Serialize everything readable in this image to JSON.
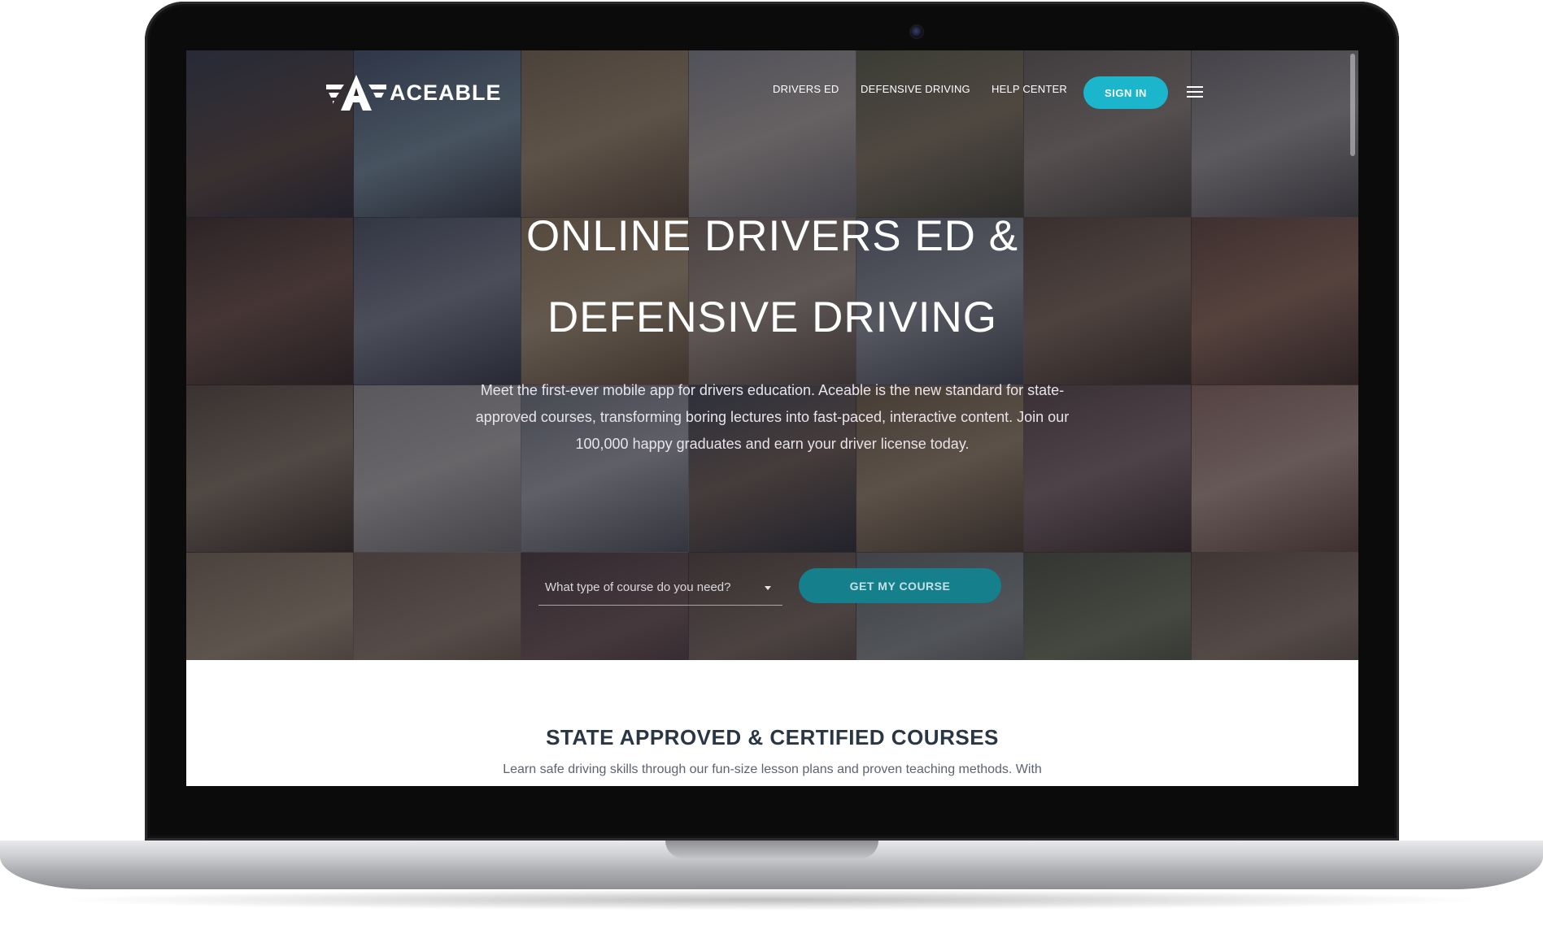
{
  "nav": {
    "logo_text": "ACEABLE",
    "links": [
      "DRIVERS ED",
      "DEFENSIVE DRIVING",
      "HELP CENTER"
    ],
    "sign_in": "SIGN IN"
  },
  "hero": {
    "title_line1": "ONLINE DRIVERS ED &",
    "title_line2": "DEFENSIVE DRIVING",
    "subtitle_line1": "Meet the first-ever mobile app for drivers education. Aceable is the new standard for state-",
    "subtitle_line2": "approved courses, transforming boring lectures into fast-paced, interactive content. Join our",
    "subtitle_line3": "100,000 happy graduates and earn your driver license today.",
    "select_placeholder": "What type of course do you need?",
    "cta": "GET MY COURSE"
  },
  "section": {
    "title": "STATE APPROVED & CERTIFIED COURSES",
    "text": "Learn safe driving skills through our fun-size lesson plans and proven teaching methods. With"
  },
  "colors": {
    "accent": "#1bb5cc",
    "cta": "#157f8c",
    "hero_overlay": "#1c161e"
  }
}
